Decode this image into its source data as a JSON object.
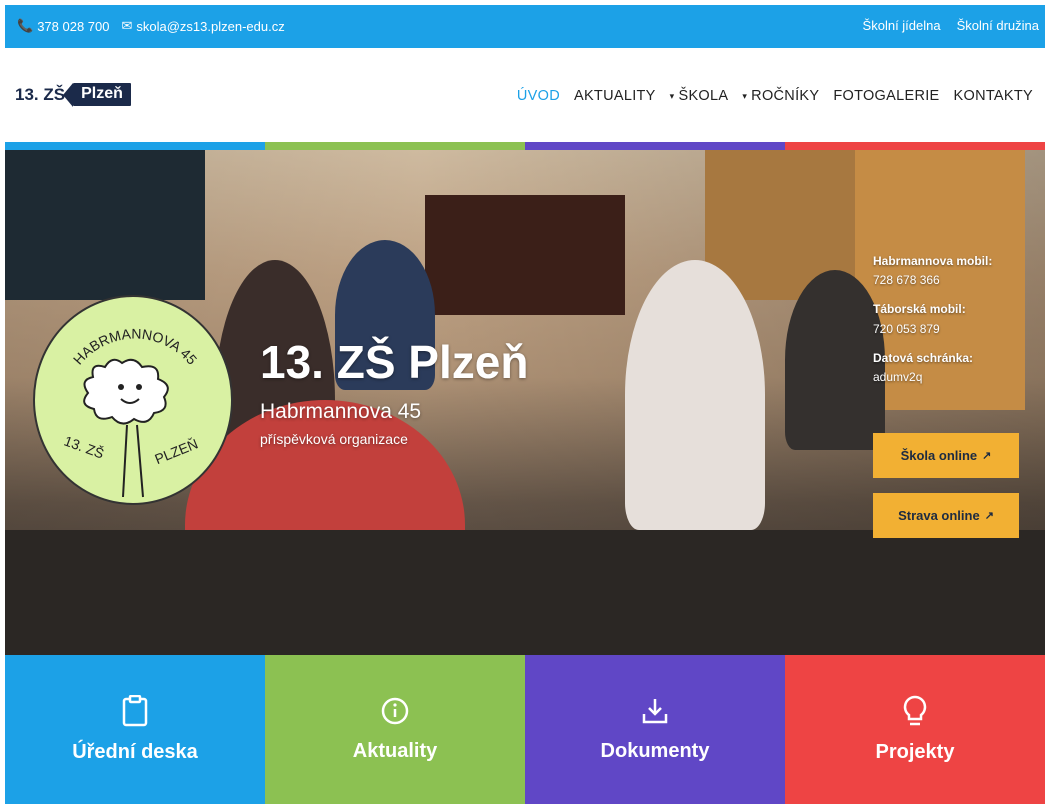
{
  "topbar": {
    "phone": "378 028 700",
    "email": "skola@zs13.plzen-edu.cz",
    "links": [
      "Školní jídelna",
      "Školní družina"
    ]
  },
  "logo": {
    "prefix": "13. ZŠ",
    "city": "Plzeň"
  },
  "nav": {
    "items": [
      {
        "label": "ÚVOD",
        "active": true,
        "dropdown": false
      },
      {
        "label": "AKTUALITY",
        "active": false,
        "dropdown": false
      },
      {
        "label": "ŠKOLA",
        "active": false,
        "dropdown": true
      },
      {
        "label": "ROČNÍKY",
        "active": false,
        "dropdown": true
      },
      {
        "label": "FOTOGALERIE",
        "active": false,
        "dropdown": false
      },
      {
        "label": "KONTAKTY",
        "active": false,
        "dropdown": false
      }
    ]
  },
  "colors": {
    "blue": "#1ca1e7",
    "green": "#8cc152",
    "purple": "#6047c6",
    "red": "#ee4444",
    "cta": "#f2b033",
    "navy": "#1b2a4a"
  },
  "emblem": {
    "top_text": "HABRMANNOVA 45",
    "bottom_left": "13. ZŠ",
    "bottom_right": "PLZEŇ"
  },
  "hero": {
    "title": "13. ZŠ Plzeň",
    "subtitle": "Habrmannova 45",
    "subtitle2": "příspěvková organizace"
  },
  "contacts": {
    "items": [
      {
        "label": "Habrmannova mobil:",
        "value": "728 678 366"
      },
      {
        "label": "Táborská mobil:",
        "value": "720 053 879"
      },
      {
        "label": "Datová schránka:",
        "value": "adumv2q"
      }
    ]
  },
  "cta": {
    "skola": "Škola online",
    "strava": "Strava online",
    "ext_icon": "↗"
  },
  "tiles": [
    {
      "label": "Úřední deska",
      "icon": "clipboard-icon"
    },
    {
      "label": "Aktuality",
      "icon": "info-icon"
    },
    {
      "label": "Dokumenty",
      "icon": "download-icon"
    },
    {
      "label": "Projekty",
      "icon": "lightbulb-icon"
    }
  ]
}
